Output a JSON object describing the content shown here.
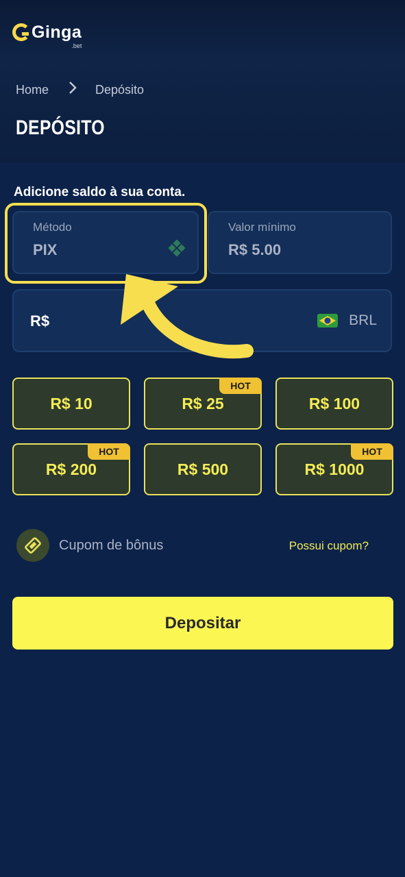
{
  "brand": {
    "name": "Ginga",
    "sub": ".bet"
  },
  "breadcrumb": {
    "home": "Home",
    "separator": ">",
    "current": "Depósito"
  },
  "page_title": "DEPÓSITO",
  "lead_text": "Adicione saldo à sua conta.",
  "method": {
    "label": "Método",
    "value": "PIX",
    "icon": "pix-icon"
  },
  "min_value": {
    "label": "Valor mínimo",
    "value": "R$ 5.00"
  },
  "amount": {
    "prefix": "R$",
    "currency": "BRL",
    "flag": "brazil-flag-icon"
  },
  "quick_amounts": [
    {
      "label": "R$ 10",
      "badge": ""
    },
    {
      "label": "R$ 25",
      "badge": "HOT"
    },
    {
      "label": "R$ 100",
      "badge": ""
    },
    {
      "label": "R$ 200",
      "badge": "HOT"
    },
    {
      "label": "R$ 500",
      "badge": ""
    },
    {
      "label": "R$ 1000",
      "badge": "HOT"
    }
  ],
  "coupon": {
    "label": "Cupom de bônus",
    "link": "Possui cupom?",
    "icon": "ticket-icon"
  },
  "deposit_button": "Depositar",
  "colors": {
    "background": "#0c2249",
    "accent_yellow": "#fbf652",
    "highlight": "#f7de4f",
    "hot_badge": "#f0c233"
  }
}
